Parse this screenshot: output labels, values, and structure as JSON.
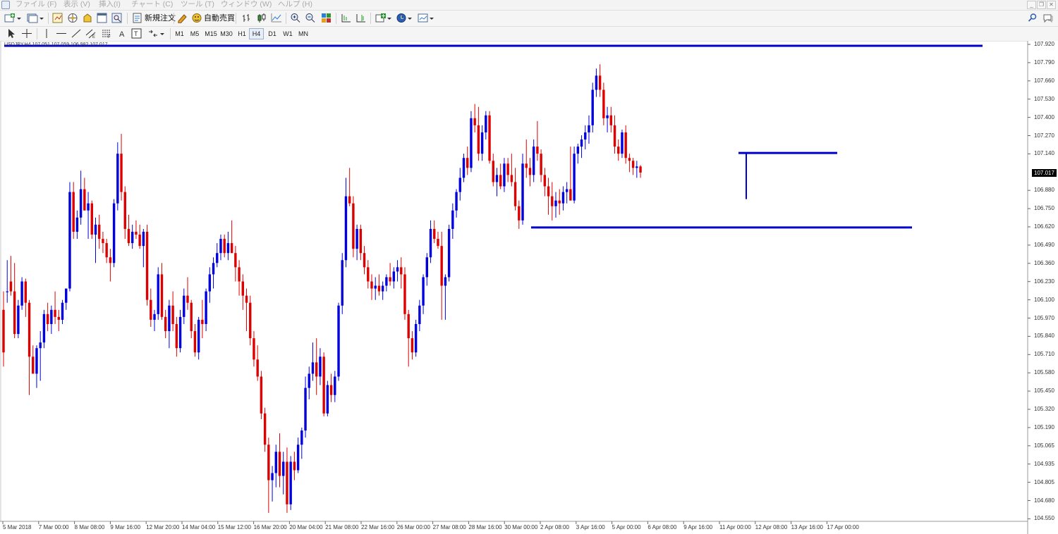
{
  "menu": [
    "ファイル (F)",
    "表示 (V)",
    "挿入(I)",
    "チャート (C)",
    "ツール (T)",
    "ウィンドウ (W)",
    "ヘルプ (H)"
  ],
  "toolbar": {
    "new_order_label": "新規注文",
    "auto_trading_label": "自動売買",
    "timeframes": [
      "M1",
      "M5",
      "M15",
      "M30",
      "H1",
      "H4",
      "D1",
      "W1",
      "MN"
    ],
    "active_timeframe": "H4"
  },
  "chart": {
    "header": "USDJPY,H4  107.051 107.059 106.982 107.017",
    "current_price": "107.017",
    "up_color": "#0000dd",
    "down_color": "#dd0000",
    "line_color": "#0000cc"
  },
  "chart_data": {
    "type": "candlestick",
    "price_ticks": [
      "107.920",
      "107.790",
      "107.660",
      "107.530",
      "107.400",
      "107.270",
      "107.140",
      "107.017",
      "106.880",
      "106.750",
      "106.620",
      "106.490",
      "106.360",
      "106.230",
      "106.100",
      "105.970",
      "105.840",
      "105.710",
      "105.580",
      "105.450",
      "105.320",
      "105.190",
      "105.065",
      "104.935",
      "104.805",
      "104.680",
      "104.550"
    ],
    "time_ticks": [
      "5 Mar 2018",
      "7 Mar 00:00",
      "8 Mar 08:00",
      "9 Mar 16:00",
      "12 Mar 20:00",
      "14 Mar 04:00",
      "15 Mar 12:00",
      "16 Mar 20:00",
      "20 Mar 04:00",
      "21 Mar 08:00",
      "22 Mar 16:00",
      "26 Mar 00:00",
      "27 Mar 08:00",
      "28 Mar 16:00",
      "30 Mar 00:00",
      "2 Apr 08:00",
      "3 Apr 16:00",
      "5 Apr 00:00",
      "6 Apr 08:00",
      "9 Apr 16:00",
      "11 Apr 00:00",
      "12 Apr 08:00",
      "13 Apr 16:00",
      "17 Apr 00:00"
    ],
    "candles": [
      [
        106.05,
        106.18,
        105.65,
        105.75
      ],
      [
        106.18,
        106.4,
        106.1,
        106.18
      ],
      [
        106.25,
        106.43,
        106.15,
        106.18
      ],
      [
        106.18,
        106.38,
        105.85,
        105.88
      ],
      [
        105.88,
        106.12,
        105.85,
        106.08
      ],
      [
        106.08,
        106.28,
        106.05,
        106.25
      ],
      [
        106.25,
        106.27,
        106.0,
        106.1
      ],
      [
        106.1,
        106.12,
        105.45,
        105.72
      ],
      [
        105.72,
        105.8,
        105.6,
        105.6
      ],
      [
        105.6,
        105.8,
        105.5,
        105.78
      ],
      [
        105.78,
        105.9,
        105.55,
        105.82
      ],
      [
        105.82,
        106.05,
        105.78,
        106.02
      ],
      [
        106.02,
        106.1,
        105.9,
        105.95
      ],
      [
        105.95,
        106.08,
        105.88,
        106.05
      ],
      [
        106.05,
        106.18,
        105.95,
        106.0
      ],
      [
        106.0,
        106.05,
        105.9,
        105.98
      ],
      [
        105.98,
        106.12,
        105.95,
        106.1
      ],
      [
        106.1,
        106.2,
        106.05,
        106.2
      ],
      [
        106.2,
        106.95,
        106.18,
        106.88
      ],
      [
        106.88,
        106.95,
        106.55,
        106.6
      ],
      [
        106.6,
        106.75,
        106.55,
        106.7
      ],
      [
        106.7,
        107.03,
        106.65,
        106.9
      ],
      [
        106.9,
        106.98,
        106.75,
        106.75
      ],
      [
        106.75,
        106.88,
        106.55,
        106.8
      ],
      [
        106.8,
        106.82,
        106.55,
        106.58
      ],
      [
        106.58,
        106.7,
        106.38,
        106.65
      ],
      [
        106.65,
        106.72,
        106.48,
        106.55
      ],
      [
        106.55,
        106.6,
        106.45,
        106.52
      ],
      [
        106.52,
        106.55,
        106.38,
        106.42
      ],
      [
        106.42,
        106.48,
        106.25,
        106.38
      ],
      [
        106.38,
        106.83,
        106.35,
        106.8
      ],
      [
        106.8,
        107.23,
        106.75,
        107.15
      ],
      [
        107.15,
        107.29,
        106.82,
        106.88
      ],
      [
        106.88,
        106.92,
        106.55,
        106.62
      ],
      [
        106.62,
        106.72,
        106.5,
        106.52
      ],
      [
        106.52,
        106.65,
        106.48,
        106.6
      ],
      [
        106.6,
        106.68,
        106.55,
        106.58
      ],
      [
        106.58,
        106.65,
        106.48,
        106.5
      ],
      [
        106.5,
        106.62,
        106.35,
        106.6
      ],
      [
        106.6,
        106.65,
        106.08,
        106.12
      ],
      [
        106.12,
        106.2,
        105.93,
        105.98
      ],
      [
        105.98,
        106.05,
        105.9,
        106.02
      ],
      [
        106.02,
        106.35,
        105.98,
        106.3
      ],
      [
        106.3,
        106.38,
        105.98,
        106.0
      ],
      [
        106.0,
        106.05,
        105.85,
        105.9
      ],
      [
        105.9,
        106.12,
        105.78,
        106.08
      ],
      [
        106.08,
        106.18,
        105.9,
        105.95
      ],
      [
        105.95,
        106.0,
        105.72,
        105.78
      ],
      [
        105.78,
        106.05,
        105.75,
        106.0
      ],
      [
        106.0,
        106.2,
        105.95,
        106.15
      ],
      [
        106.15,
        106.28,
        106.05,
        106.1
      ],
      [
        106.1,
        106.12,
        105.85,
        105.9
      ],
      [
        105.9,
        105.95,
        105.72,
        105.75
      ],
      [
        105.75,
        106.0,
        105.7,
        105.98
      ],
      [
        105.98,
        106.12,
        105.85,
        105.95
      ],
      [
        105.95,
        106.2,
        105.9,
        106.18
      ],
      [
        106.18,
        106.35,
        106.1,
        106.3
      ],
      [
        106.3,
        106.42,
        106.2,
        106.38
      ],
      [
        106.38,
        106.52,
        106.35,
        106.45
      ],
      [
        106.45,
        106.58,
        106.4,
        106.55
      ],
      [
        106.55,
        106.58,
        106.42,
        106.45
      ],
      [
        106.45,
        106.6,
        106.4,
        106.52
      ],
      [
        106.52,
        106.68,
        106.45,
        106.45
      ],
      [
        106.45,
        106.5,
        106.25,
        106.35
      ],
      [
        106.35,
        106.4,
        106.15,
        106.25
      ],
      [
        106.25,
        106.3,
        106.05,
        106.15
      ],
      [
        106.15,
        106.2,
        105.9,
        106.1
      ],
      [
        106.1,
        106.15,
        105.8,
        105.85
      ],
      [
        105.85,
        105.9,
        105.65,
        105.7
      ],
      [
        105.7,
        105.8,
        105.55,
        105.58
      ],
      [
        105.58,
        105.62,
        105.28,
        105.32
      ],
      [
        105.32,
        105.36,
        105.05,
        105.1
      ],
      [
        105.1,
        105.15,
        104.62,
        104.85
      ],
      [
        104.85,
        104.95,
        104.7,
        104.9
      ],
      [
        104.9,
        105.1,
        104.8,
        105.05
      ],
      [
        105.05,
        105.18,
        104.8,
        104.88
      ],
      [
        104.88,
        105.05,
        104.75,
        104.98
      ],
      [
        104.98,
        105.08,
        104.62,
        104.68
      ],
      [
        104.68,
        105.02,
        104.64,
        104.98
      ],
      [
        104.98,
        105.05,
        104.85,
        104.92
      ],
      [
        104.92,
        105.15,
        104.9,
        105.1
      ],
      [
        105.1,
        105.22,
        105.0,
        105.2
      ],
      [
        105.2,
        105.58,
        105.15,
        105.5
      ],
      [
        105.5,
        105.65,
        105.42,
        105.6
      ],
      [
        105.6,
        105.82,
        105.55,
        105.68
      ],
      [
        105.68,
        105.85,
        105.45,
        105.58
      ],
      [
        105.58,
        105.78,
        105.52,
        105.72
      ],
      [
        105.72,
        105.75,
        105.3,
        105.32
      ],
      [
        105.32,
        105.55,
        105.3,
        105.52
      ],
      [
        105.52,
        105.6,
        105.4,
        105.45
      ],
      [
        105.45,
        105.62,
        105.4,
        105.58
      ],
      [
        105.58,
        106.1,
        105.55,
        106.08
      ],
      [
        106.08,
        106.45,
        106.02,
        106.4
      ],
      [
        106.4,
        106.98,
        106.35,
        106.85
      ],
      [
        106.85,
        107.05,
        106.78,
        106.8
      ],
      [
        106.8,
        106.85,
        106.42,
        106.48
      ],
      [
        106.48,
        106.65,
        106.4,
        106.62
      ],
      [
        106.62,
        106.65,
        106.4,
        106.45
      ],
      [
        106.45,
        106.5,
        106.3,
        106.35
      ],
      [
        106.35,
        106.4,
        106.2,
        106.25
      ],
      [
        106.25,
        106.3,
        106.12,
        106.2
      ],
      [
        106.2,
        106.28,
        106.12,
        106.22
      ],
      [
        106.22,
        106.3,
        106.15,
        106.18
      ],
      [
        106.18,
        106.25,
        106.12,
        106.22
      ],
      [
        106.22,
        106.3,
        106.18,
        106.28
      ],
      [
        106.28,
        106.38,
        106.22,
        106.25
      ],
      [
        106.25,
        106.35,
        106.2,
        106.32
      ],
      [
        106.32,
        106.4,
        106.25,
        106.35
      ],
      [
        106.35,
        106.42,
        106.2,
        106.3
      ],
      [
        106.3,
        106.35,
        105.98,
        106.02
      ],
      [
        106.02,
        106.05,
        105.65,
        105.85
      ],
      [
        105.85,
        105.9,
        105.7,
        105.75
      ],
      [
        105.75,
        105.98,
        105.72,
        105.95
      ],
      [
        105.95,
        106.12,
        105.9,
        106.08
      ],
      [
        106.08,
        106.3,
        106.02,
        106.28
      ],
      [
        106.28,
        106.45,
        106.22,
        106.42
      ],
      [
        106.42,
        106.68,
        106.38,
        106.62
      ],
      [
        106.62,
        106.68,
        106.52,
        106.55
      ],
      [
        106.55,
        106.6,
        106.48,
        106.5
      ],
      [
        106.5,
        106.6,
        105.98,
        106.22
      ],
      [
        106.22,
        106.3,
        105.98,
        106.28
      ],
      [
        106.28,
        106.65,
        106.25,
        106.62
      ],
      [
        106.62,
        106.8,
        106.55,
        106.75
      ],
      [
        106.75,
        106.9,
        106.7,
        106.88
      ],
      [
        106.88,
        107.05,
        106.82,
        106.98
      ],
      [
        106.98,
        107.15,
        106.95,
        107.12
      ],
      [
        107.12,
        107.2,
        107.0,
        107.05
      ],
      [
        107.05,
        107.45,
        107.02,
        107.4
      ],
      [
        107.4,
        107.5,
        107.3,
        107.35
      ],
      [
        107.35,
        107.48,
        107.1,
        107.15
      ],
      [
        107.15,
        107.35,
        107.1,
        107.3
      ],
      [
        107.3,
        107.45,
        107.25,
        107.42
      ],
      [
        107.42,
        107.45,
        107.08,
        107.1
      ],
      [
        107.1,
        107.15,
        106.92,
        106.95
      ],
      [
        106.95,
        107.05,
        106.85,
        107.0
      ],
      [
        107.0,
        107.08,
        106.9,
        106.92
      ],
      [
        106.92,
        107.12,
        106.88,
        107.08
      ],
      [
        107.08,
        107.12,
        106.95,
        107.0
      ],
      [
        107.0,
        107.15,
        106.92,
        106.95
      ],
      [
        106.95,
        107.05,
        106.75,
        106.78
      ],
      [
        106.78,
        106.82,
        106.62,
        106.68
      ],
      [
        106.68,
        107.15,
        106.65,
        107.08
      ],
      [
        107.08,
        107.25,
        106.98,
        107.05
      ],
      [
        107.05,
        107.12,
        106.92,
        107.0
      ],
      [
        107.0,
        107.25,
        106.95,
        107.2
      ],
      [
        107.2,
        107.38,
        107.1,
        107.15
      ],
      [
        107.15,
        107.18,
        106.95,
        107.0
      ],
      [
        107.0,
        107.05,
        106.85,
        106.92
      ],
      [
        106.92,
        106.98,
        106.72,
        106.85
      ],
      [
        106.85,
        106.95,
        106.68,
        106.78
      ],
      [
        106.78,
        106.88,
        106.7,
        106.82
      ],
      [
        106.82,
        106.9,
        106.72,
        106.8
      ],
      [
        106.8,
        106.92,
        106.75,
        106.88
      ],
      [
        106.88,
        106.95,
        106.8,
        106.9
      ],
      [
        106.9,
        107.2,
        106.82,
        106.82
      ],
      [
        106.82,
        107.2,
        106.8,
        107.15
      ],
      [
        107.15,
        107.22,
        107.08,
        107.2
      ],
      [
        107.2,
        107.28,
        107.12,
        107.25
      ],
      [
        107.25,
        107.35,
        107.18,
        107.3
      ],
      [
        107.3,
        107.42,
        107.22,
        107.35
      ],
      [
        107.35,
        107.65,
        107.3,
        107.6
      ],
      [
        107.6,
        107.75,
        107.55,
        107.7
      ],
      [
        107.7,
        107.78,
        107.55,
        107.6
      ],
      [
        107.6,
        107.65,
        107.35,
        107.4
      ],
      [
        107.4,
        107.48,
        107.3,
        107.42
      ],
      [
        107.42,
        107.48,
        107.3,
        107.35
      ],
      [
        107.35,
        107.42,
        107.15,
        107.2
      ],
      [
        107.2,
        107.25,
        107.1,
        107.15
      ],
      [
        107.15,
        107.32,
        107.12,
        107.3
      ],
      [
        107.3,
        107.35,
        107.08,
        107.12
      ],
      [
        107.12,
        107.15,
        107.02,
        107.1
      ],
      [
        107.1,
        107.12,
        107.0,
        107.05
      ],
      [
        107.05,
        107.1,
        106.98,
        107.06
      ],
      [
        107.06,
        107.07,
        106.98,
        107.017
      ]
    ],
    "horizontal_lines": [
      106.63,
      107.155,
      107.91
    ]
  }
}
